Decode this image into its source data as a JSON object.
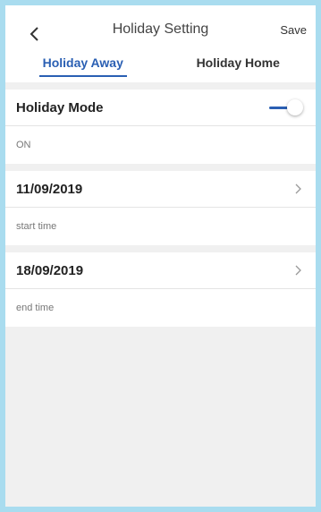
{
  "header": {
    "title": "Holiday Setting",
    "save_label": "Save",
    "back_icon": "chevron-left-icon"
  },
  "tabs": [
    {
      "label": "Holiday Away",
      "active": true
    },
    {
      "label": "Holiday Home",
      "active": false
    }
  ],
  "holiday_mode": {
    "label": "Holiday Mode",
    "status": "ON",
    "enabled": true,
    "accent_color": "#2a5fb3"
  },
  "start": {
    "date": "11/09/2019",
    "caption": "start time"
  },
  "end": {
    "date": "18/09/2019",
    "caption": "end time"
  }
}
